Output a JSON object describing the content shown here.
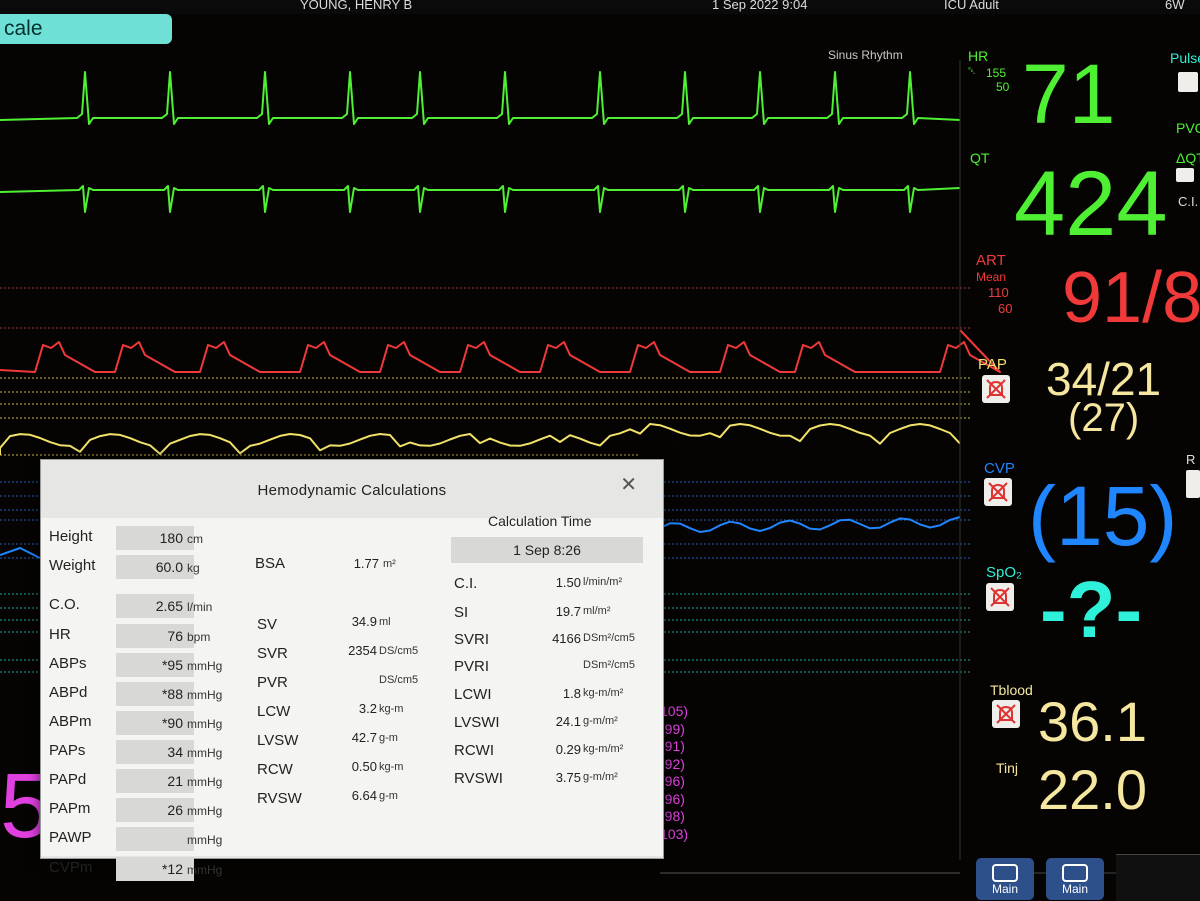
{
  "header": {
    "patient": "YOUNG, HENRY B",
    "date_time": "1 Sep 2022  9:04",
    "unit": "ICU Adult",
    "bed": "6W"
  },
  "mode_tab": "cale",
  "rhythm": "Sinus Rhythm",
  "params": {
    "hr": {
      "label": "HR",
      "high": "155",
      "low": "50",
      "value": "71"
    },
    "pulse": {
      "label": "Pulse"
    },
    "pvc": {
      "label": "PVC"
    },
    "dqt": {
      "label": "ΔQT"
    },
    "ci_side": {
      "label": "C.I."
    },
    "qt": {
      "label": "QT",
      "value": "424"
    },
    "art": {
      "label": "ART",
      "sublabel": "Mean",
      "high": "110",
      "low": "60",
      "value": "91/8"
    },
    "pap": {
      "label": "PAP",
      "value": "34/21",
      "mean": "(27)"
    },
    "cvp": {
      "label": "CVP",
      "value": "(15)"
    },
    "spo2": {
      "label": "SpO₂",
      "value": "-?-"
    },
    "tblood": {
      "label": "Tblood",
      "value": "36.1"
    },
    "tinj": {
      "label": "Tinj",
      "value": "22.0"
    }
  },
  "pink_values": [
    "105)",
    "(99)",
    "(91)",
    "(92)",
    "(96)",
    "(96)",
    "(98)",
    "103)"
  ],
  "pink_big": "5/",
  "main_buttons": [
    "Main",
    "Main"
  ],
  "colors": {
    "ecg": "#4ff034",
    "art": "#f03a3a",
    "pap": "#f2e26a",
    "cvp": "#1f86ff",
    "spo2": "#2ff0d8",
    "temp": "#f5e6a0",
    "pink": "#e040e0"
  },
  "dialog": {
    "title": "Hemodynamic  Calculations",
    "calc_time_label": "Calculation  Time",
    "calc_time_value": "1  Sep    8:26",
    "bsa": {
      "label": "BSA",
      "value": "1.77",
      "unit": "m²"
    },
    "left_rows": [
      {
        "label": "Height",
        "value": "180",
        "unit": "cm"
      },
      {
        "label": "Weight",
        "value": "60.0",
        "unit": "kg"
      },
      {
        "label": "C.O.",
        "value": "2.65",
        "unit": "l/min"
      },
      {
        "label": "HR",
        "value": "76",
        "unit": "bpm"
      },
      {
        "label": "ABPs",
        "value": "*95",
        "unit": "mmHg"
      },
      {
        "label": "ABPd",
        "value": "*88",
        "unit": "mmHg"
      },
      {
        "label": "ABPm",
        "value": "*90",
        "unit": "mmHg"
      },
      {
        "label": "PAPs",
        "value": "34",
        "unit": "mmHg"
      },
      {
        "label": "PAPd",
        "value": "21",
        "unit": "mmHg"
      },
      {
        "label": "PAPm",
        "value": "26",
        "unit": "mmHg"
      },
      {
        "label": "PAWP",
        "value": "",
        "unit": "mmHg"
      },
      {
        "label": "CVPm",
        "value": "*12",
        "unit": "mmHg"
      }
    ],
    "mid_rows": [
      {
        "label": "SV",
        "value": "34.9",
        "unit": "ml"
      },
      {
        "label": "SVR",
        "value": "2354",
        "unit": "DS/cm5"
      },
      {
        "label": "PVR",
        "value": "",
        "unit": "DS/cm5"
      },
      {
        "label": "LCW",
        "value": "3.2",
        "unit": "kg-m"
      },
      {
        "label": "LVSW",
        "value": "42.7",
        "unit": "g-m"
      },
      {
        "label": "RCW",
        "value": "0.50",
        "unit": "kg-m"
      },
      {
        "label": "RVSW",
        "value": "6.64",
        "unit": "g-m"
      }
    ],
    "right_rows": [
      {
        "label": "C.I.",
        "value": "1.50",
        "unit": "l/min/m²"
      },
      {
        "label": "SI",
        "value": "19.7",
        "unit": "ml/m²"
      },
      {
        "label": "SVRI",
        "value": "4166",
        "unit": "DSm²/cm5"
      },
      {
        "label": "PVRI",
        "value": "",
        "unit": "DSm²/cm5"
      },
      {
        "label": "LCWI",
        "value": "1.8",
        "unit": "kg-m/m²"
      },
      {
        "label": "LVSWI",
        "value": "24.1",
        "unit": "g-m/m²"
      },
      {
        "label": "RCWI",
        "value": "0.29",
        "unit": "kg-m/m²"
      },
      {
        "label": "RVSWI",
        "value": "3.75",
        "unit": "g-m/m²"
      }
    ]
  }
}
